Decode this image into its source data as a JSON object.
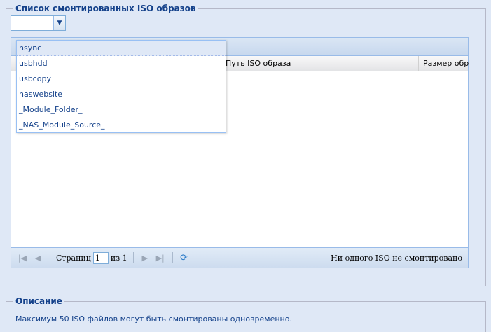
{
  "mounted": {
    "legend": "Список смонтированных ISO образов",
    "combo": {
      "value": ""
    },
    "dropdown_items": [
      "nsync",
      "usbhdd",
      "usbcopy",
      "naswebsite",
      "_Module_Folder_",
      "_NAS_Module_Source_"
    ],
    "grid": {
      "columns": [
        "Путь ISO образа",
        "Размер обр"
      ],
      "paging": {
        "page_label": "Страниц",
        "page_value": "1",
        "of_label": "из 1",
        "message": "Ни одного ISO не смонтировано"
      }
    }
  },
  "description": {
    "legend": "Описание",
    "text": "Максимум 50 ISO файлов могут быть смонтированы одновременно."
  }
}
